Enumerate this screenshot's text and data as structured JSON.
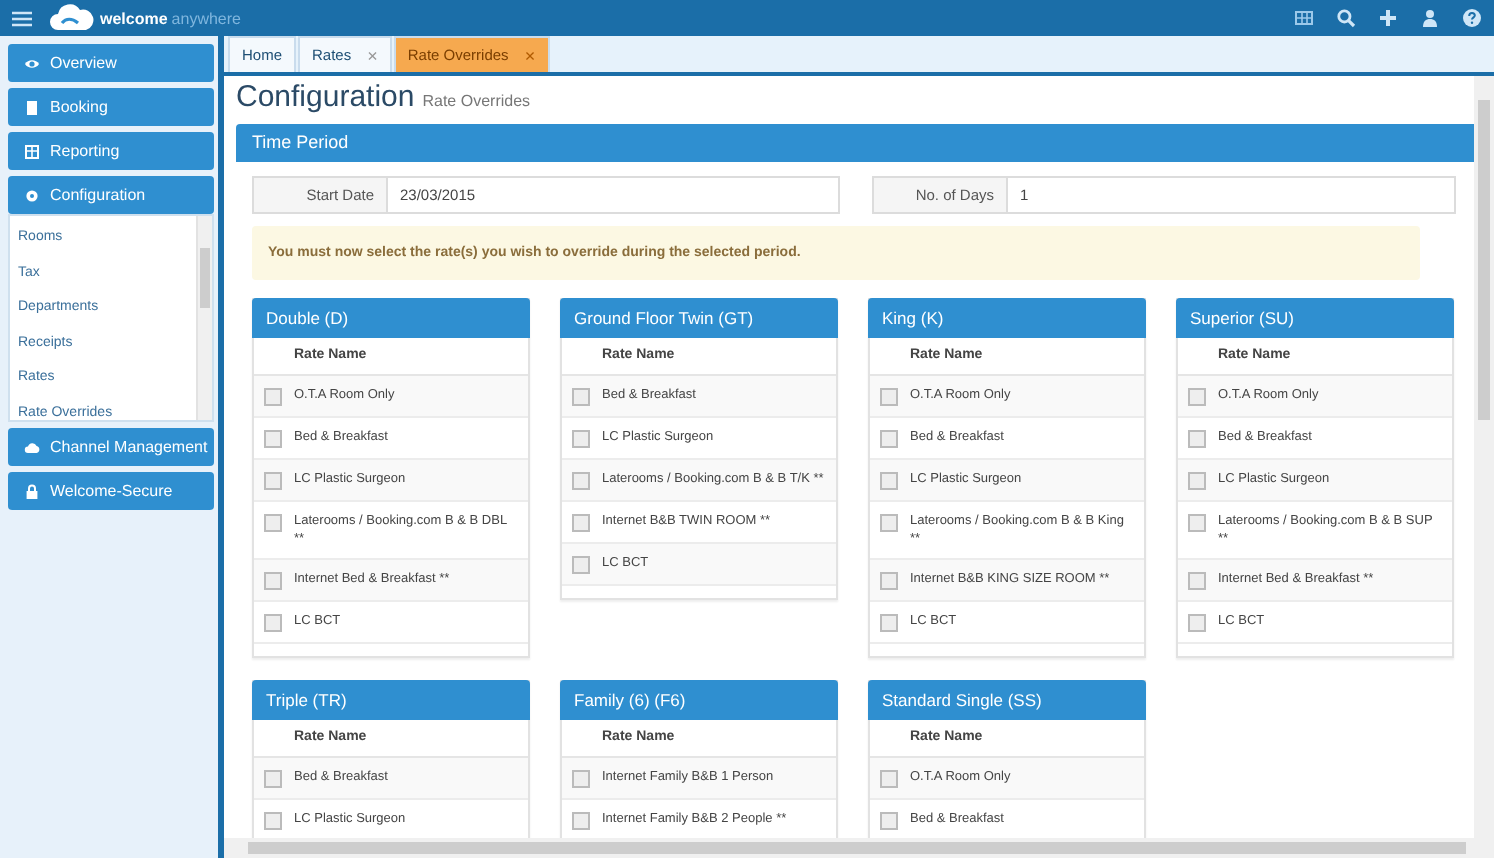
{
  "header": {
    "logo_text": "welcome",
    "logo_subtext": "anywhere"
  },
  "sidebar": {
    "items": [
      {
        "label": "Overview"
      },
      {
        "label": "Booking"
      },
      {
        "label": "Reporting"
      },
      {
        "label": "Configuration",
        "children": [
          "Rooms",
          "Tax",
          "Departments",
          "Receipts",
          "Rates",
          "Rate Overrides"
        ]
      },
      {
        "label": "Channel Management"
      },
      {
        "label": "Welcome-Secure"
      }
    ]
  },
  "tabs": [
    {
      "label": "Home",
      "selected": false
    },
    {
      "label": "Rates",
      "close": "×",
      "selected": false
    },
    {
      "label": "Rate Overrides",
      "close": "×",
      "selected": true
    }
  ],
  "page": {
    "title": "Configuration",
    "subtitle": "Rate Overrides"
  },
  "time_period": {
    "title": "Time Period",
    "fields": [
      {
        "label": "Start Date",
        "value": "23/03/2015"
      },
      {
        "label": "No. of Days",
        "value": "1"
      }
    ],
    "notice": "You must now select the rate(s) you wish to override during the selected period."
  },
  "room_types": [
    {
      "title": "Double (D)",
      "column": "Rate Name",
      "rates": [
        {
          "name": "O.T.A Room Only",
          "checked": false
        },
        {
          "name": "Bed & Breakfast",
          "checked": false
        },
        {
          "name": "LC Plastic Surgeon",
          "checked": false
        },
        {
          "name": "Laterooms / Booking.com B & B DBL **",
          "checked": false
        },
        {
          "name": "Internet Bed & Breakfast **",
          "checked": false
        },
        {
          "name": "LC BCT",
          "checked": false
        }
      ]
    },
    {
      "title": "Ground Floor Twin (GT)",
      "column": "Rate Name",
      "rates": [
        {
          "name": "Bed & Breakfast",
          "checked": false
        },
        {
          "name": "LC Plastic Surgeon",
          "checked": false
        },
        {
          "name": "Laterooms / Booking.com B & B T/K **",
          "checked": false
        },
        {
          "name": "Internet B&B TWIN ROOM **",
          "checked": false
        },
        {
          "name": "LC BCT",
          "checked": false
        }
      ]
    },
    {
      "title": "King (K)",
      "column": "Rate Name",
      "rates": [
        {
          "name": "O.T.A Room Only",
          "checked": false
        },
        {
          "name": "Bed & Breakfast",
          "checked": false
        },
        {
          "name": "LC Plastic Surgeon",
          "checked": false
        },
        {
          "name": "Laterooms / Booking.com B & B King **",
          "checked": false
        },
        {
          "name": "Internet B&B KING SIZE ROOM **",
          "checked": false
        },
        {
          "name": "LC BCT",
          "checked": false
        }
      ]
    },
    {
      "title": "Superior (SU)",
      "column": "Rate Name",
      "rates": [
        {
          "name": "O.T.A Room Only",
          "checked": false
        },
        {
          "name": "Bed & Breakfast",
          "checked": false
        },
        {
          "name": "LC Plastic Surgeon",
          "checked": false
        },
        {
          "name": "Laterooms / Booking.com B & B SUP **",
          "checked": false
        },
        {
          "name": "Internet Bed & Breakfast **",
          "checked": false
        },
        {
          "name": "LC BCT",
          "checked": false
        }
      ]
    },
    {
      "title": "Triple (TR)",
      "column": "Rate Name",
      "rates": [
        {
          "name": "Bed & Breakfast",
          "checked": false
        },
        {
          "name": "LC Plastic Surgeon",
          "checked": false
        }
      ]
    },
    {
      "title": "Family (6) (F6)",
      "column": "Rate Name",
      "rates": [
        {
          "name": "Internet Family B&B 1 Person",
          "checked": false
        },
        {
          "name": "Internet Family B&B 2 People **",
          "checked": false
        }
      ]
    },
    {
      "title": "Standard Single (SS)",
      "column": "Rate Name",
      "rates": [
        {
          "name": "O.T.A Room Only",
          "checked": false
        },
        {
          "name": "Bed & Breakfast",
          "checked": false
        }
      ]
    }
  ]
}
